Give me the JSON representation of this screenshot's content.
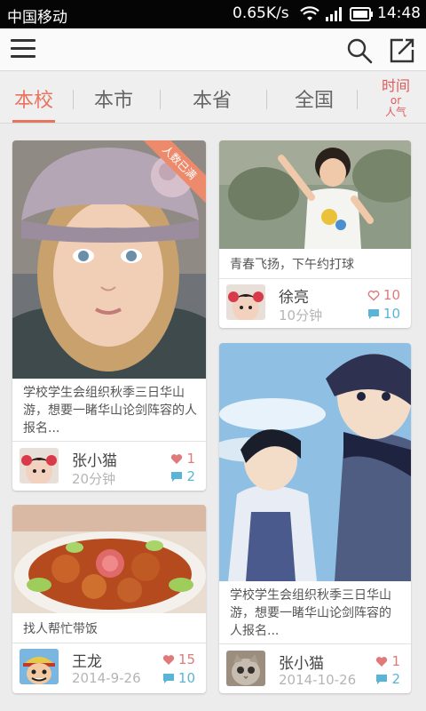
{
  "status_bar": {
    "carrier": "中国移动",
    "net_speed": "0.65K/s",
    "time": "14:48"
  },
  "tabs": [
    {
      "label": "本校",
      "active": true
    },
    {
      "label": "本市"
    },
    {
      "label": "本省"
    },
    {
      "label": "全国"
    }
  ],
  "sort": {
    "line1": "时间",
    "line2": "or",
    "line3": "人气"
  },
  "cards": [
    {
      "badge": "人数已满",
      "caption": "学校学生会组织秋季三日华山游，想要一睹华山论剑阵容的人报名...",
      "user": "张小猫",
      "time": "20分钟",
      "likes": "1",
      "comments": "2"
    },
    {
      "caption": "青春飞扬，下午约打球",
      "user": "徐亮",
      "time": "10分钟",
      "likes": "10",
      "comments": "10"
    },
    {
      "caption": "学校学生会组织秋季三日华山游，想要一睹华山论剑阵容的人报名...",
      "user": "张小猫",
      "time": "2014-10-26",
      "likes": "1",
      "comments": "2"
    },
    {
      "caption": "找人帮忙带饭",
      "user": "王龙",
      "time": "2014-9-26",
      "likes": "15",
      "comments": "10"
    }
  ],
  "colors": {
    "accent": "#e8745f",
    "like": "#e07a7a",
    "comment": "#5ab4d8"
  }
}
